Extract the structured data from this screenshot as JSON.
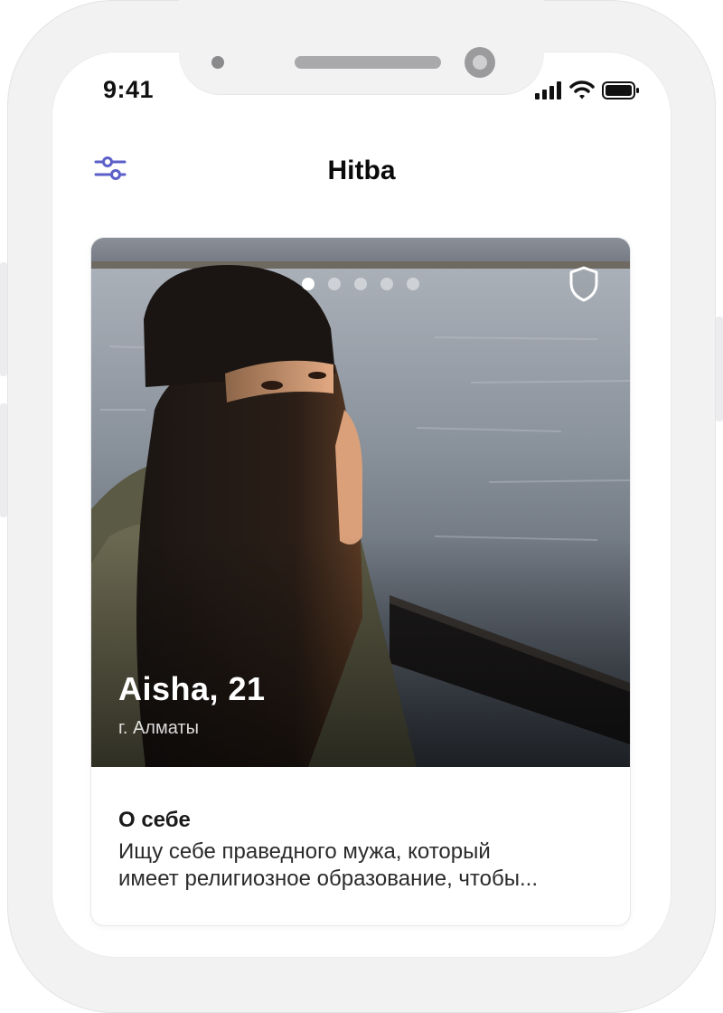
{
  "status_bar": {
    "time": "9:41",
    "icons": [
      "signal-icon",
      "wifi-icon",
      "battery-icon"
    ]
  },
  "header": {
    "title": "Hitba",
    "left_icon": "filter-sliders-icon"
  },
  "profile": {
    "photo_count": 5,
    "active_photo_index": 1,
    "name_age": "Aisha, 21",
    "city": "г. Алматы",
    "verification_icon": "shield-icon"
  },
  "about": {
    "title": "О себе",
    "text": "Ищу себе праведного мужа, который\nимеет религиозное образование, чтобы..."
  },
  "colors": {
    "accent": "#5b5fc7",
    "title": "#0a0a0a",
    "frame": "#f2f2f3"
  }
}
